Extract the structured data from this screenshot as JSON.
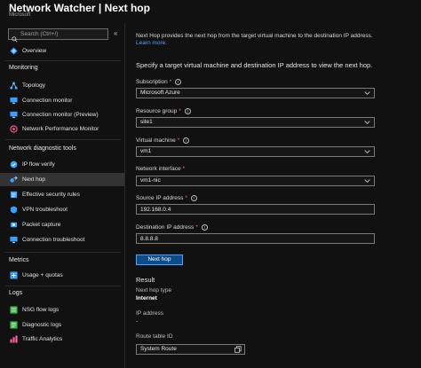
{
  "header": {
    "title": "Network Watcher | Next hop",
    "subtitle": "Microsoft"
  },
  "search": {
    "placeholder": "Search (Ctrl+/)",
    "collapse_glyph": "«"
  },
  "sidebar": {
    "overview": "Overview",
    "sections": [
      {
        "label": "Monitoring",
        "items": [
          "Topology",
          "Connection monitor",
          "Connection monitor (Preview)",
          "Network Performance Monitor"
        ]
      },
      {
        "label": "Network diagnostic tools",
        "items": [
          "IP flow verify",
          "Next hop",
          "Effective security rules",
          "VPN troubleshoot",
          "Packet capture",
          "Connection troubleshoot"
        ]
      },
      {
        "label": "Metrics",
        "items": [
          "Usage + quotas"
        ]
      },
      {
        "label": "Logs",
        "items": [
          "NSG flow logs",
          "Diagnostic logs",
          "Traffic Analytics"
        ]
      }
    ],
    "active_item": "Next hop"
  },
  "main": {
    "description": "Next Hop provides the next hop from the target virtual machine to the destination IP address.",
    "learn_more": "Learn more.",
    "instruction": "Specify a target virtual machine and destination IP address to view the next hop.",
    "fields": {
      "subscription": {
        "label": "Subscription",
        "value": "Microsoft Azure"
      },
      "resource_group": {
        "label": "Resource group",
        "value": "site1"
      },
      "virtual_machine": {
        "label": "Virtual machine",
        "value": "vm1"
      },
      "network_interface": {
        "label": "Network interface",
        "value": "vm1-nic"
      },
      "source_ip": {
        "label": "Source IP address",
        "value": "192.168.0.4"
      },
      "destination_ip": {
        "label": "Destination IP address",
        "value": "8.8.8.8"
      }
    },
    "button": "Next hop",
    "result": {
      "title": "Result",
      "next_hop_type_label": "Next hop type",
      "next_hop_type_value": "Internet",
      "ip_address_label": "IP address",
      "ip_address_value": "-",
      "route_table_label": "Route table ID",
      "route_table_value": "System Route"
    }
  },
  "colors": {
    "accent": "#4fa3ff",
    "button_bg": "#0b4c8c",
    "required": "#ff6b6b",
    "active_row": "#333333"
  }
}
